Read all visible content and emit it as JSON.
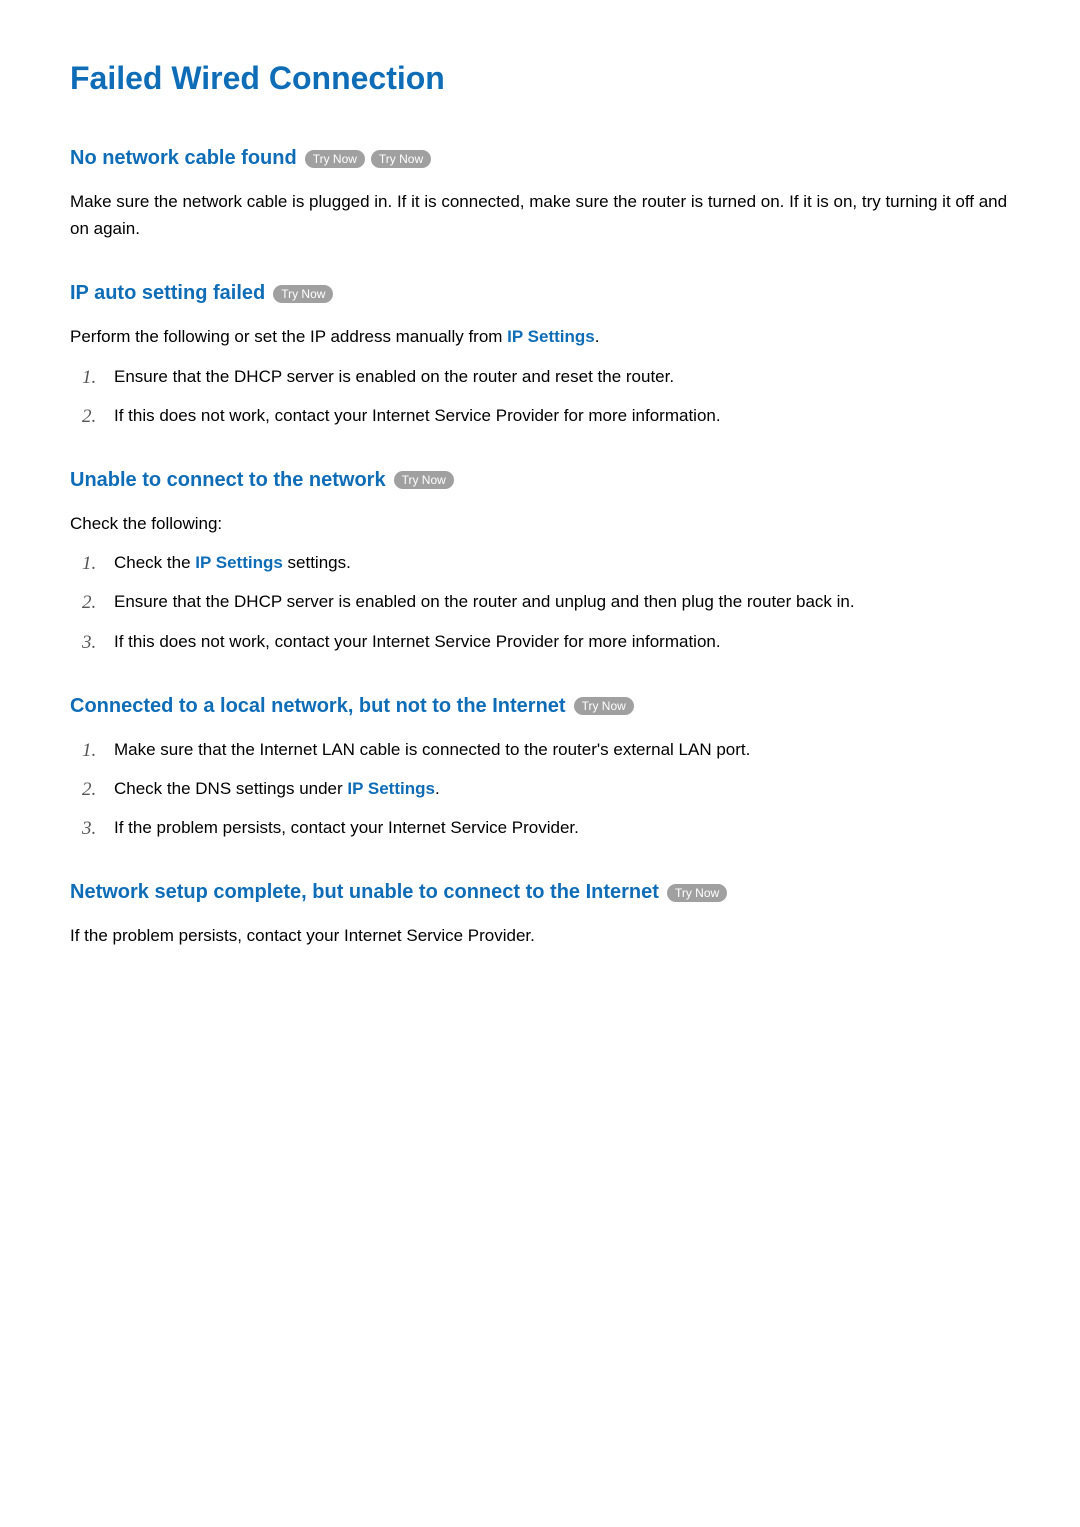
{
  "title": "Failed Wired Connection",
  "buttons": {
    "try_now": "Try Now"
  },
  "links": {
    "ip_settings": "IP Settings"
  },
  "sections": {
    "no_cable": {
      "heading": "No network cable found",
      "body": "Make sure the network cable is plugged in. If it is connected, make sure the router is turned on. If it is on, try turning it off and on again."
    },
    "ip_auto": {
      "heading": "IP auto setting failed",
      "intro_pre": "Perform the following or set the IP address manually from ",
      "intro_post": ".",
      "items": [
        "Ensure that the DHCP server is enabled on the router and reset the router.",
        "If this does not work, contact your Internet Service Provider for more information."
      ]
    },
    "unable_connect": {
      "heading": "Unable to connect to the network",
      "intro": "Check the following:",
      "item1_pre": "Check the ",
      "item1_post": " settings.",
      "items_rest": [
        "Ensure that the DHCP server is enabled on the router and unplug and then plug the router back in.",
        "If this does not work, contact your Internet Service Provider for more information."
      ]
    },
    "local_not_internet": {
      "heading": "Connected to a local network, but not to the Internet",
      "item1": "Make sure that the Internet LAN cable is connected to the router's external LAN port.",
      "item2_pre": "Check the DNS settings under ",
      "item2_post": ".",
      "item3": "If the problem persists, contact your Internet Service Provider."
    },
    "setup_complete": {
      "heading": "Network setup complete, but unable to connect to the Internet",
      "body": "If the problem persists, contact your Internet Service Provider."
    }
  }
}
